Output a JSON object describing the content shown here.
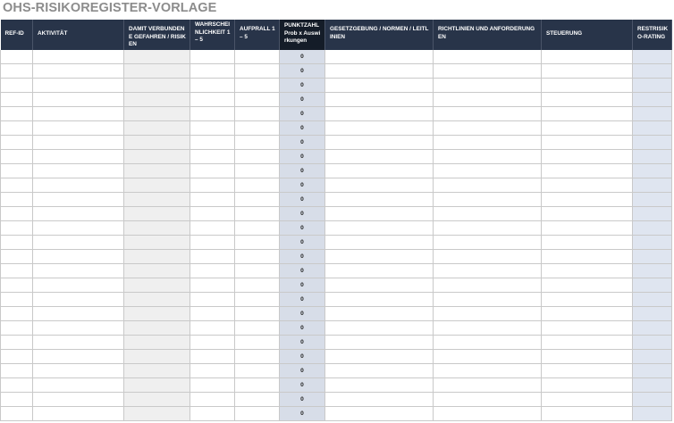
{
  "title": "OHS-RISIKOREGISTER-VORLAGE",
  "columns": [
    {
      "label": "REF-ID"
    },
    {
      "label": "AKTIVITÄT"
    },
    {
      "label": "DAMIT VERBUNDENE GEFAHREN / RISIKEN"
    },
    {
      "label": "WAHRSCHEINLICHKEIT 1 – 5"
    },
    {
      "label": "AUFPRALL 1 – 5"
    },
    {
      "label": "PUNKTZAHL Prob x Auswirkungen"
    },
    {
      "label": "GESETZGEBUNG / NORMEN / LEITLINIEN"
    },
    {
      "label": "RICHTLINIEN UND ANFORDERUNGEN"
    },
    {
      "label": "STEUERUNG"
    },
    {
      "label": "RESTRISIKO-RATING"
    }
  ],
  "score_values": [
    "0",
    "0",
    "0",
    "0",
    "0",
    "0",
    "0",
    "0",
    "0",
    "0",
    "0",
    "0",
    "0",
    "0",
    "0",
    "0",
    "0",
    "0",
    "0",
    "0",
    "0",
    "0",
    "0",
    "0",
    "0",
    "0"
  ],
  "colors": {
    "header_bg": "#283449",
    "score_header_bg": "#141c28",
    "title_text": "#8c8c8c",
    "hazard_col_bg": "#efefef",
    "score_col_bg": "#d7dde8",
    "residual_col_bg": "#dfe5f0"
  }
}
